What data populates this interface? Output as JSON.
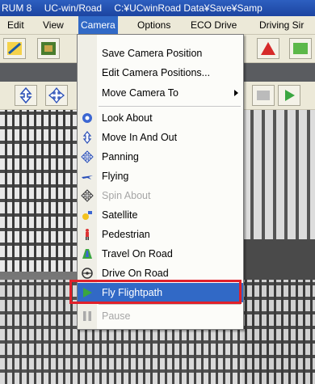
{
  "window": {
    "title_parts": [
      "RUM 8",
      "UC-win/Road",
      "C:¥UCwinRoad Data¥Save¥Samp"
    ]
  },
  "menubar": {
    "items": [
      "Edit",
      "View",
      "Camera",
      "Options",
      "ECO Drive",
      "Driving Sir"
    ],
    "active": "Camera"
  },
  "camera_menu": {
    "items": [
      {
        "label": "Save Camera Position",
        "icon": "none",
        "enabled": true
      },
      {
        "label": "Edit Camera Positions...",
        "icon": "none",
        "enabled": true
      },
      {
        "label": "Move Camera To",
        "icon": "none",
        "enabled": true,
        "submenu": true
      },
      {
        "label": "Look About",
        "icon": "look-about-icon",
        "enabled": true
      },
      {
        "label": "Move In And Out",
        "icon": "move-in-out-icon",
        "enabled": true
      },
      {
        "label": "Panning",
        "icon": "panning-icon",
        "enabled": true
      },
      {
        "label": "Flying",
        "icon": "flying-icon",
        "enabled": true
      },
      {
        "label": "Spin About",
        "icon": "spin-about-icon",
        "enabled": false
      },
      {
        "label": "Satellite",
        "icon": "satellite-icon",
        "enabled": true
      },
      {
        "label": "Pedestrian",
        "icon": "pedestrian-icon",
        "enabled": true
      },
      {
        "label": "Travel On Road",
        "icon": "travel-on-road-icon",
        "enabled": true
      },
      {
        "label": "Drive On Road",
        "icon": "drive-on-road-icon",
        "enabled": true
      },
      {
        "label": "Fly Flightpath",
        "icon": "fly-flightpath-icon",
        "enabled": true,
        "selected": true
      },
      {
        "label": "Pause",
        "icon": "pause-icon",
        "enabled": false
      }
    ]
  },
  "colors": {
    "selection": "#3169c6",
    "highlight_box": "#e0202a",
    "titlebar": "#2d5fc0"
  }
}
